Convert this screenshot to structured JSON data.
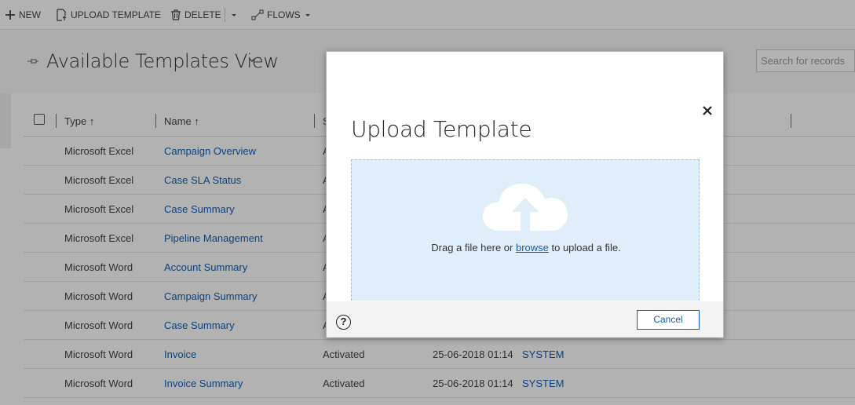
{
  "toolbar": {
    "new_label": "NEW",
    "upload_label": "UPLOAD TEMPLATE",
    "delete_label": "DELETE",
    "flows_label": "FLOWS"
  },
  "view": {
    "title": "Available Templates View",
    "search_placeholder": "Search for records"
  },
  "grid": {
    "columns": [
      "Type ↑",
      "Name ↑",
      "S"
    ],
    "rows": [
      {
        "type": "Microsoft Excel",
        "name": "Campaign Overview",
        "status": "A",
        "date": "",
        "owner": ""
      },
      {
        "type": "Microsoft Excel",
        "name": "Case SLA Status",
        "status": "A",
        "date": "",
        "owner": ""
      },
      {
        "type": "Microsoft Excel",
        "name": "Case Summary",
        "status": "A",
        "date": "",
        "owner": ""
      },
      {
        "type": "Microsoft Excel",
        "name": "Pipeline Management",
        "status": "A",
        "date": "",
        "owner": ""
      },
      {
        "type": "Microsoft Word",
        "name": "Account Summary",
        "status": "A",
        "date": "",
        "owner": ""
      },
      {
        "type": "Microsoft Word",
        "name": "Campaign Summary",
        "status": "A",
        "date": "",
        "owner": ""
      },
      {
        "type": "Microsoft Word",
        "name": "Case Summary",
        "status": "A",
        "date": "",
        "owner": ""
      },
      {
        "type": "Microsoft Word",
        "name": "Invoice",
        "status": "Activated",
        "date": "25-06-2018 01:14",
        "owner": "SYSTEM"
      },
      {
        "type": "Microsoft Word",
        "name": "Invoice Summary",
        "status": "Activated",
        "date": "25-06-2018 01:14",
        "owner": "SYSTEM"
      }
    ]
  },
  "dialog": {
    "title": "Upload Template",
    "drop_text_before": "Drag a file here or ",
    "browse_label": "browse",
    "drop_text_after": " to upload a file.",
    "cancel_label": "Cancel",
    "help_label": "?"
  },
  "colors": {
    "accent": "#1160b7",
    "dropzone_bg": "#e1eef9"
  },
  "icons": [
    "plus-icon",
    "upload-document-icon",
    "trash-icon",
    "chevron-down-icon",
    "flow-icon",
    "pin-icon",
    "close-icon",
    "cloud-upload-icon",
    "help-icon"
  ]
}
